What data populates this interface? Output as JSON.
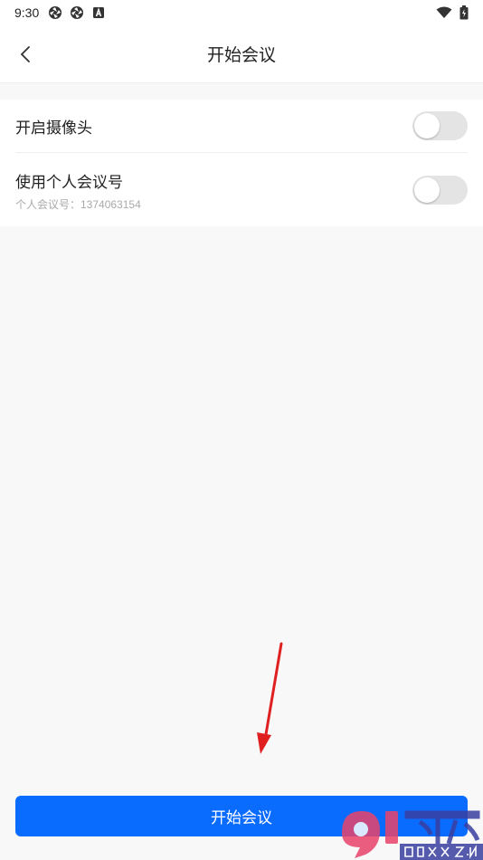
{
  "status_bar": {
    "time": "9:30",
    "left_icons": [
      "aperture-icon",
      "aperture-icon",
      "a-box-icon"
    ],
    "right_icons": [
      "wifi-icon",
      "battery-icon"
    ]
  },
  "header": {
    "title": "开始会议",
    "back_icon": "chevron-left-icon"
  },
  "settings": {
    "camera": {
      "label": "开启摄像头",
      "enabled": false
    },
    "personal_id": {
      "label": "使用个人会议号",
      "sub": "个人会议号：1374063154",
      "enabled": false
    }
  },
  "start_button": {
    "label": "开始会议"
  },
  "colors": {
    "primary": "#0a6cff",
    "background": "#f8f8f8",
    "toggle_off": "#e4e4e4",
    "annotation_arrow": "#e02020"
  },
  "watermark": {
    "top": "下载站",
    "bottom": "91xz.net"
  }
}
